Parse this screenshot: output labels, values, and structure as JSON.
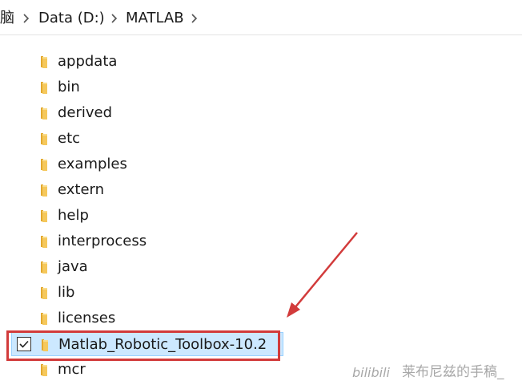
{
  "breadcrumb": {
    "items": [
      "脑",
      "Data (D:)",
      "MATLAB"
    ]
  },
  "files": [
    {
      "name": "appdata",
      "selected": false
    },
    {
      "name": "bin",
      "selected": false
    },
    {
      "name": "derived",
      "selected": false
    },
    {
      "name": "etc",
      "selected": false
    },
    {
      "name": "examples",
      "selected": false
    },
    {
      "name": "extern",
      "selected": false
    },
    {
      "name": "help",
      "selected": false
    },
    {
      "name": "interprocess",
      "selected": false
    },
    {
      "name": "java",
      "selected": false
    },
    {
      "name": "lib",
      "selected": false
    },
    {
      "name": "licenses",
      "selected": false
    },
    {
      "name": "Matlab_Robotic_Toolbox-10.2",
      "selected": true
    },
    {
      "name": "mcr",
      "selected": false
    }
  ],
  "watermark": {
    "text": "莱布尼兹的手稿_"
  },
  "colors": {
    "selection_bg": "#cce8ff",
    "selection_border": "#99d1ff",
    "annotation": "#d23b3b",
    "folder_yellow": "#f5c85c"
  },
  "icons": {
    "folder": "folder-icon",
    "separator": "chevron-right-icon",
    "checkbox": "checkbox-checked-icon"
  }
}
